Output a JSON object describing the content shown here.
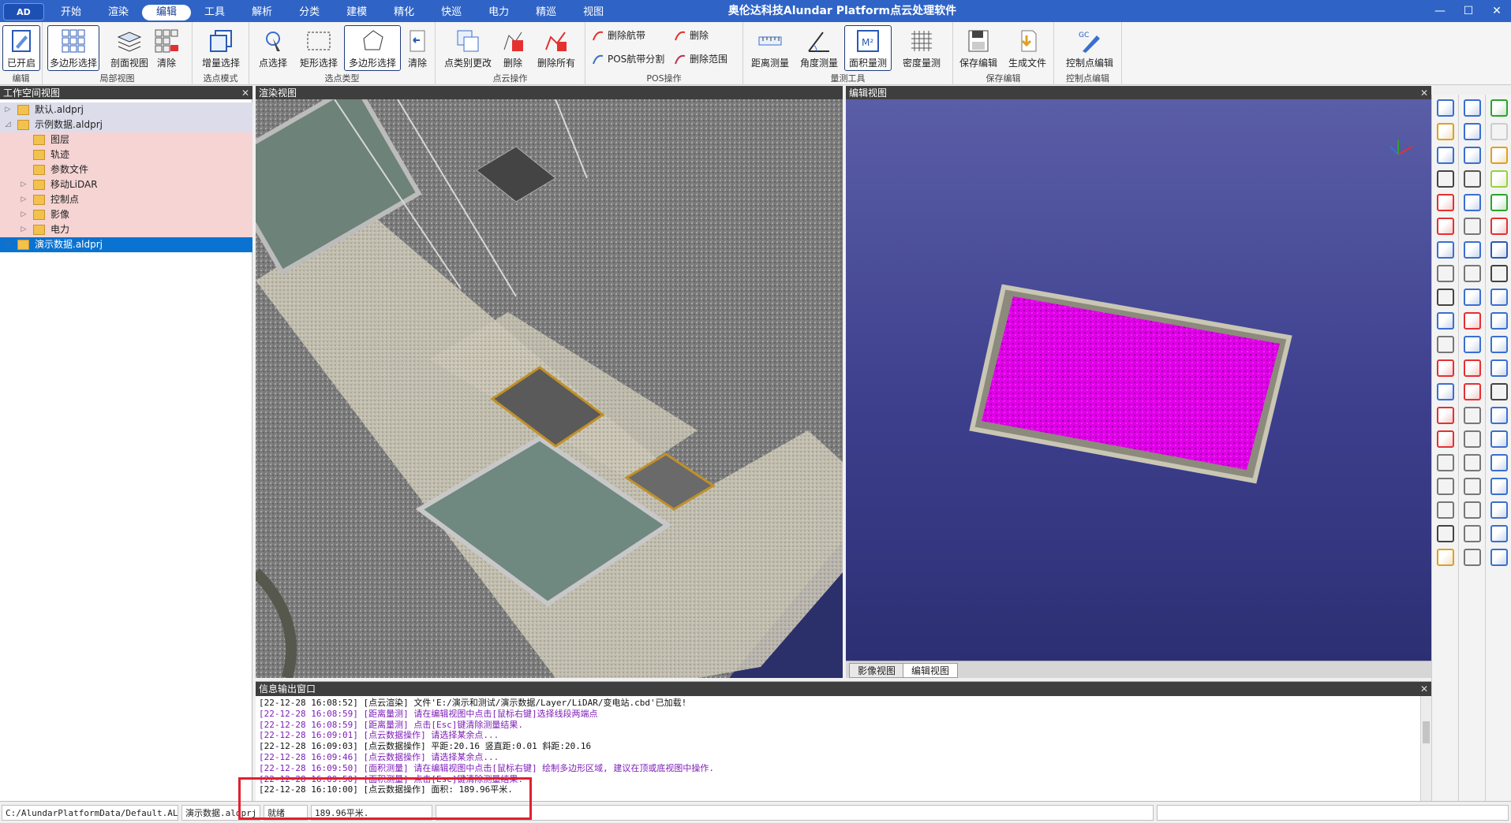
{
  "app": {
    "title": "奥伦达科技Alundar Platform点云处理软件",
    "logo_text": "AD",
    "window_controls": [
      "—",
      "☐",
      "✕"
    ]
  },
  "menu": [
    "开始",
    "渲染",
    "编辑",
    "工具",
    "解析",
    "分类",
    "建模",
    "精化",
    "快巡",
    "电力",
    "精巡",
    "视图"
  ],
  "menu_active": "编辑",
  "ribbon": {
    "groups": {
      "edit": "编辑",
      "local_view": "局部视图",
      "select_mode": "选点模式",
      "select_type": "选点类型",
      "point_ops": "点云操作",
      "pos_ops": "POS操作",
      "measure": "量测工具",
      "save_edit": "保存编辑",
      "ctrl_edit": "控制点编辑"
    },
    "buttons": {
      "opened": "已开启",
      "poly_select_view": "多边形选择",
      "profile_view": "剖面视图",
      "clear_view": "清除",
      "incremental_select": "增量选择",
      "point_select": "点选择",
      "rect_select": "矩形选择",
      "poly_select": "多边形选择",
      "clear_select": "清除",
      "classify_change": "点类别更改",
      "delete": "删除",
      "delete_all": "删除所有",
      "delete_route": "删除航带",
      "pos_split": "POS航带分割",
      "pos_delete": "删除",
      "delete_range": "删除范围",
      "distance": "距离测量",
      "angle": "角度测量",
      "area": "面积量测",
      "density": "密度量测",
      "save_edit": "保存编辑",
      "gen_file": "生成文件",
      "ctrl_point_edit": "控制点编辑"
    }
  },
  "workspace": {
    "title": "工作空间视图",
    "items": [
      {
        "label": "默认.aldprj",
        "level": 0,
        "expander": "▷",
        "bg": "#dcdcea"
      },
      {
        "label": "示例数据.aldprj",
        "level": 0,
        "expander": "◿",
        "bg": "#dcdcea"
      },
      {
        "label": "图层",
        "level": 1,
        "expander": "",
        "bg": "#f6d4d4"
      },
      {
        "label": "轨迹",
        "level": 1,
        "expander": "",
        "bg": "#f6d4d4"
      },
      {
        "label": "参数文件",
        "level": 1,
        "expander": "",
        "bg": "#f6d4d4"
      },
      {
        "label": "移动LiDAR",
        "level": 1,
        "expander": "▷",
        "bg": "#f6d4d4"
      },
      {
        "label": "控制点",
        "level": 1,
        "expander": "▷",
        "bg": "#f6d4d4"
      },
      {
        "label": "影像",
        "level": 1,
        "expander": "▷",
        "bg": "#f6d4d4"
      },
      {
        "label": "电力",
        "level": 1,
        "expander": "▷",
        "bg": "#f6d4d4"
      },
      {
        "label": "演示数据.aldprj",
        "level": 0,
        "expander": "▷",
        "bg": "#0a73d1"
      }
    ]
  },
  "render_view": {
    "title": "渲染视图"
  },
  "edit_view": {
    "title": "编辑视图",
    "tabs": [
      "影像视图",
      "编辑视图"
    ],
    "active_tab": "编辑视图",
    "selection_color": "#e000e8"
  },
  "info_panel": {
    "title": "信息输出窗口",
    "lines": [
      {
        "text": "[22-12-28 16:08:52] [点云渲染] 文件'E:/演示和测试/演示数据/Layer/LiDAR/变电站.cbd'已加载!",
        "color": "black"
      },
      {
        "text": "[22-12-28 16:08:59] [距离量测] 请在编辑视图中点击[鼠标右键]选择线段两端点",
        "color": "purple"
      },
      {
        "text": "[22-12-28 16:08:59] [距离量测] 点击[Esc]键清除测量结果.",
        "color": "purple"
      },
      {
        "text": "[22-12-28 16:09:01] [点云数据操作] 请选择某余点...",
        "color": "purple"
      },
      {
        "text": "[22-12-28 16:09:03] [点云数据操作] 平距:20.16 竖直距:0.01 斜距:20.16",
        "color": "black"
      },
      {
        "text": "[22-12-28 16:09:46] [点云数据操作] 请选择某余点...",
        "color": "purple"
      },
      {
        "text": "[22-12-28 16:09:50] [面积测量] 请在编辑视图中点击[鼠标右键] 绘制多边形区域, 建议在顶或底视图中操作.",
        "color": "purple"
      },
      {
        "text": "[22-12-28 16:09:50] [面积测量] 点击[Esc]键清除测量结果.",
        "color": "purple"
      },
      {
        "text": "[22-12-28 16:10:00] [点云数据操作] 面积: 189.96平米.",
        "color": "black"
      }
    ]
  },
  "status": {
    "path": "C:/AlundarPlatformData/Default.ALDWS",
    "project": "演示数据.aldprj",
    "state": "就绪",
    "message": "189.96平米."
  }
}
